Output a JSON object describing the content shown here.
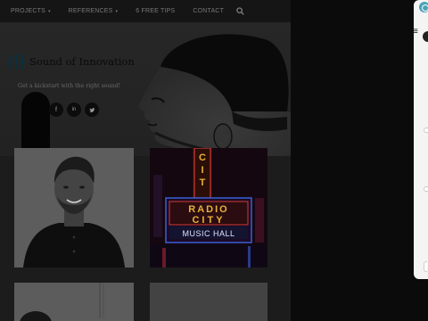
{
  "nav": {
    "items": [
      {
        "label": "PROJECTS",
        "dropdown": true
      },
      {
        "label": "REFERENCES",
        "dropdown": true
      },
      {
        "label": "6 FREE TIPS",
        "dropdown": false
      },
      {
        "label": "CONTACT",
        "dropdown": false
      }
    ],
    "caret": "▾",
    "search_icon": "search-icon"
  },
  "hero": {
    "brand": "Sound of Innovation",
    "tagline": "Get a kickstart with the right sound!",
    "logo_icon": "equalizer-sliders-icon",
    "social": [
      {
        "name": "facebook-icon",
        "glyph": "f"
      },
      {
        "name": "linkedin-icon",
        "glyph": "in"
      },
      {
        "name": "twitter-icon",
        "glyph": "t"
      }
    ]
  },
  "cards": {
    "radio_sign": {
      "line1": "RADIO",
      "line2": "CITY",
      "line3": "MUSIC HALL"
    }
  },
  "side_panel": {
    "menu_icon": "≡"
  },
  "colors": {
    "overlay": "#1c1c1c",
    "accent": "#4aa3b8",
    "neon_red": "#d23a32",
    "neon_gold": "#e9b13a",
    "neon_blue": "#3a5fd8"
  }
}
